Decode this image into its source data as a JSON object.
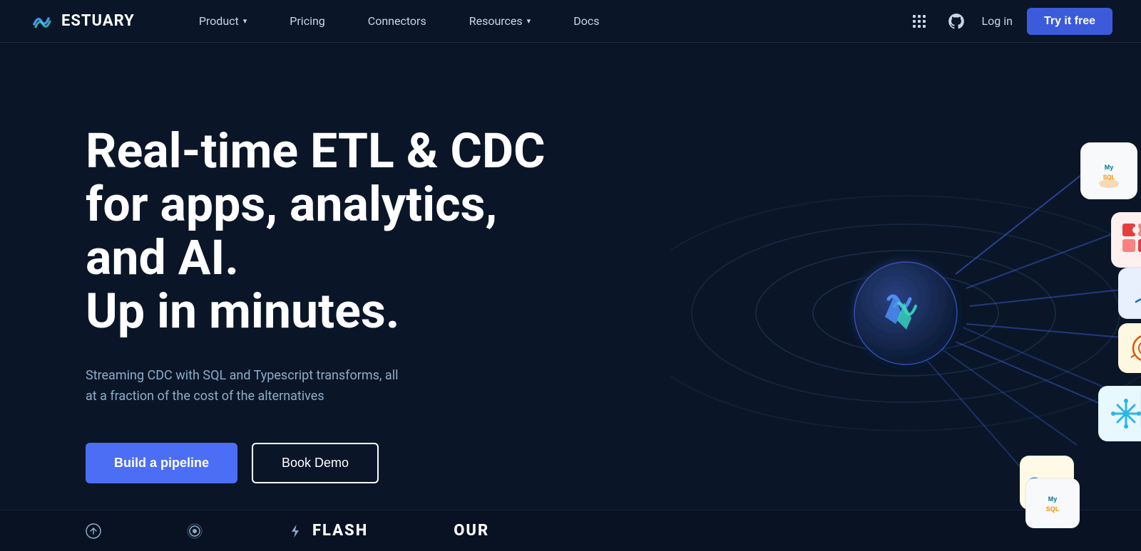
{
  "nav": {
    "logo_text": "ESTUARY",
    "links": [
      {
        "label": "Product",
        "has_dropdown": true
      },
      {
        "label": "Pricing",
        "has_dropdown": false
      },
      {
        "label": "Connectors",
        "has_dropdown": false
      },
      {
        "label": "Resources",
        "has_dropdown": true
      },
      {
        "label": "Docs",
        "has_dropdown": false
      }
    ],
    "login_label": "Log in",
    "try_free_label": "Try it free"
  },
  "hero": {
    "title_line1": "Real-time ETL & CDC",
    "title_line2": "for apps, analytics, and AI.",
    "title_line3": "Up in minutes.",
    "subtitle": "Streaming CDC with SQL and Typescript transforms, all at a fraction of the cost of the alternatives",
    "btn_primary": "Build a pipeline",
    "btn_secondary": "Book Demo"
  },
  "bottom_bar": {
    "items": [
      {
        "icon": "arrow-up-icon",
        "text": ""
      },
      {
        "icon": "circle-icon",
        "text": ""
      },
      {
        "icon": "flash-icon",
        "text": "FLASH"
      },
      {
        "icon": "our-icon",
        "text": "OUR"
      }
    ]
  },
  "connectors": [
    {
      "name": "mysql",
      "color": "#e8f4fb",
      "icon_color": "#00758f"
    },
    {
      "name": "puzzle",
      "color": "#fde8e8",
      "icon_color": "#e53e3e"
    },
    {
      "name": "salesforce",
      "color": "#e8f0fe",
      "icon_color": "#1565c0"
    },
    {
      "name": "kafka",
      "color": "#f0fde8",
      "icon_color": "#2d6a4f"
    },
    {
      "name": "snowflake",
      "color": "#e8f4fb",
      "icon_color": "#29b5e8"
    },
    {
      "name": "bigquery",
      "color": "#fef9e8",
      "icon_color": "#fbbc04"
    },
    {
      "name": "databricks",
      "color": "#fde8e8",
      "icon_color": "#e53935"
    },
    {
      "name": "mysql2",
      "color": "#e8f4fb",
      "icon_color": "#00758f"
    }
  ],
  "colors": {
    "bg": "#0a1628",
    "nav_bg": "#0a1628",
    "accent": "#4c6ef5",
    "text_muted": "#8eacc8"
  }
}
